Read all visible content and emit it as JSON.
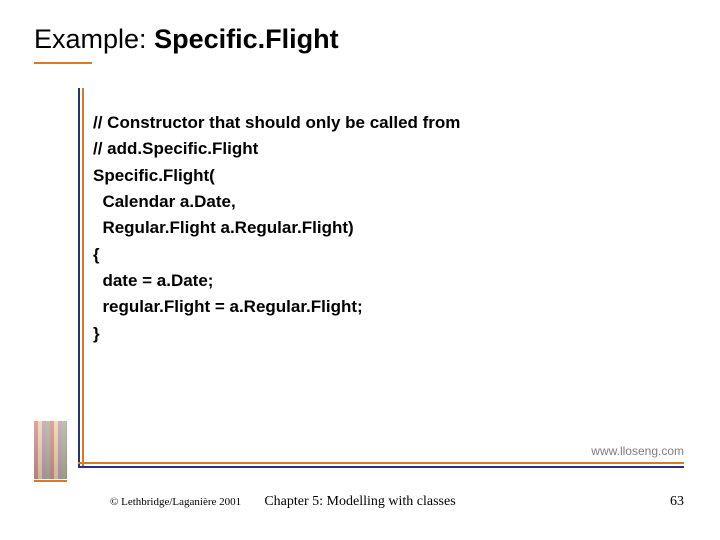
{
  "title": {
    "plain": "Example: ",
    "bold": "Specific.Flight"
  },
  "code": {
    "l1": "// Constructor that should only be called from",
    "l2": "// add.Specific.Flight",
    "l3": "Specific.Flight(",
    "l4": "  Calendar a.Date,",
    "l5": "  Regular.Flight a.Regular.Flight)",
    "l6": "{",
    "l7": "  date = a.Date;",
    "l8": "  regular.Flight = a.Regular.Flight;",
    "l9": "}"
  },
  "footer": {
    "url": "www.lloseng.com",
    "copyright": "© Lethbridge/Laganière 2001",
    "chapter": "Chapter 5: Modelling with classes",
    "page": "63"
  }
}
